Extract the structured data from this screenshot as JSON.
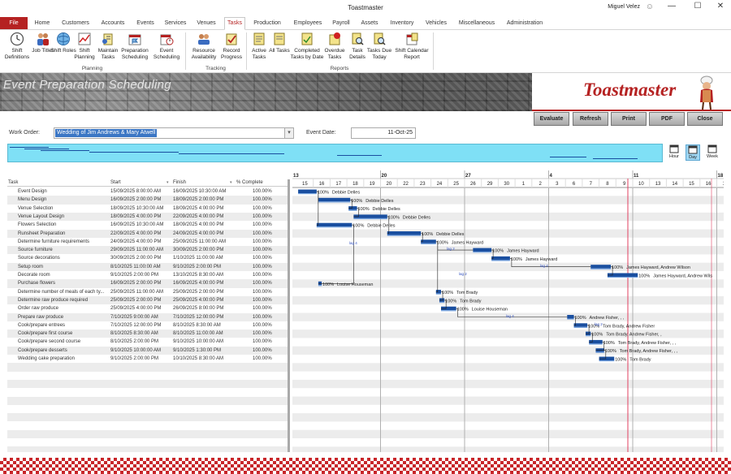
{
  "window": {
    "title": "Toastmaster",
    "user": "Miguel Velez",
    "minimize": "—",
    "maximize": "☐",
    "close": "✕"
  },
  "tabs": [
    {
      "label": "File"
    },
    {
      "label": "Home"
    },
    {
      "label": "Customers"
    },
    {
      "label": "Accounts"
    },
    {
      "label": "Events"
    },
    {
      "label": "Services"
    },
    {
      "label": "Venues"
    },
    {
      "label": "Tasks",
      "active": true
    },
    {
      "label": "Production"
    },
    {
      "label": "Employees"
    },
    {
      "label": "Payroll"
    },
    {
      "label": "Assets"
    },
    {
      "label": "Inventory"
    },
    {
      "label": "Vehicles"
    },
    {
      "label": "Miscellaneous"
    },
    {
      "label": "Administration"
    }
  ],
  "ribbon": {
    "groups": [
      {
        "label": "Planning",
        "buttons": [
          {
            "label": "Shift Definitions",
            "icon": "clock-icon"
          },
          {
            "label": "Job Titles",
            "icon": "people-icon"
          },
          {
            "label": "Shift Roles",
            "icon": "globe-icon"
          },
          {
            "label": "Shift Planning",
            "icon": "chart-icon"
          },
          {
            "label": "Maintain Tasks",
            "icon": "tasks-icon"
          },
          {
            "label": "Preparation Scheduling",
            "icon": "calendar-flag-icon"
          },
          {
            "label": "Event Scheduling",
            "icon": "calendar-clock-icon"
          }
        ]
      },
      {
        "label": "Tracking",
        "buttons": [
          {
            "label": "Resource Availability",
            "icon": "resource-icon"
          },
          {
            "label": "Record Progress",
            "icon": "progress-icon"
          }
        ]
      },
      {
        "label": "Reports",
        "buttons": [
          {
            "label": "Active Tasks",
            "icon": "report-icon"
          },
          {
            "label": "All Tasks",
            "icon": "report-icon"
          },
          {
            "label": "Completed Tasks by Date",
            "icon": "report-icon"
          },
          {
            "label": "Overdue Tasks",
            "icon": "overdue-icon"
          },
          {
            "label": "Task Details",
            "icon": "report-search-icon"
          },
          {
            "label": "Tasks Due Today",
            "icon": "report-search-icon"
          },
          {
            "label": "Shift Calendar Report",
            "icon": "calendar-report-icon"
          }
        ]
      }
    ]
  },
  "banner": {
    "page_title": "Event Preparation Scheduling",
    "logo": "Toastmaster"
  },
  "actions": {
    "evaluate": "Evaluate",
    "refresh": "Refresh",
    "print": "Print",
    "pdf": "PDF",
    "close": "Close"
  },
  "form": {
    "work_order_label": "Work Order:",
    "work_order_value": "Wedding of Jim Andrews & Mary Atwell",
    "event_date_label": "Event Date:",
    "event_date_value": "11-Oct-25"
  },
  "zoom": {
    "hour": "Hour",
    "day": "Day",
    "week": "Week"
  },
  "table": {
    "headers": {
      "task": "Task",
      "start": "Start",
      "finish": "Finish",
      "pct": "% Complete"
    },
    "rows": [
      {
        "task": "Event Design",
        "start": "15/09/2025 8:00:00 AM",
        "finish": "16/09/2025 10:30:00 AM",
        "pct": "100.00%"
      },
      {
        "task": "Menu Design",
        "start": "16/09/2025 2:00:00 PM",
        "finish": "18/09/2025 2:00:00 PM",
        "pct": "100.00%"
      },
      {
        "task": "Venue Selection",
        "start": "18/09/2025 10:30:00 AM",
        "finish": "18/09/2025 4:00:00 PM",
        "pct": "100.00%"
      },
      {
        "task": "Venue Layout Design",
        "start": "18/09/2025 4:00:00 PM",
        "finish": "22/09/2025 4:00:00 PM",
        "pct": "100.00%"
      },
      {
        "task": "Flowers Selection",
        "start": "16/09/2025 10:30:00 AM",
        "finish": "18/09/2025 4:00:00 PM",
        "pct": "100.00%"
      },
      {
        "task": "Runsheet Preparation",
        "start": "22/09/2025 4:00:00 PM",
        "finish": "24/09/2025 4:00:00 PM",
        "pct": "100.00%"
      },
      {
        "task": "Determine furniture requirements",
        "start": "24/09/2025 4:00:00 PM",
        "finish": "25/09/2025 11:00:00 AM",
        "pct": "100.00%"
      },
      {
        "task": "Source furniture",
        "start": "29/09/2025 11:00:00 AM",
        "finish": "30/09/2025 2:00:00 PM",
        "pct": "100.00%"
      },
      {
        "task": "Source decorations",
        "start": "30/09/2025 2:00:00 PM",
        "finish": "1/10/2025 11:00:00 AM",
        "pct": "100.00%"
      },
      {
        "task": "Setup room",
        "start": "8/10/2025 11:00:00 AM",
        "finish": "9/10/2025 2:00:00 PM",
        "pct": "100.00%"
      },
      {
        "task": "Decorate room",
        "start": "9/10/2025 2:00:00 PM",
        "finish": "13/10/2025 8:30:00 AM",
        "pct": "100.00%"
      },
      {
        "task": "Purchase flowers",
        "start": "16/09/2025 2:00:00 PM",
        "finish": "16/09/2025 4:00:00 PM",
        "pct": "100.00%"
      },
      {
        "task": "Determine number of meals of each ty...",
        "start": "25/09/2025 11:00:00 AM",
        "finish": "25/09/2025 2:00:00 PM",
        "pct": "100.00%"
      },
      {
        "task": "Determine raw produce required",
        "start": "25/09/2025 2:00:00 PM",
        "finish": "25/09/2025 4:00:00 PM",
        "pct": "100.00%"
      },
      {
        "task": "Order raw produce",
        "start": "25/09/2025 4:00:00 PM",
        "finish": "26/09/2025 8:00:00 PM",
        "pct": "100.00%"
      },
      {
        "task": "Prepare raw produce",
        "start": "7/10/2025 9:00:00 AM",
        "finish": "7/10/2025 12:00:00 PM",
        "pct": "100.00%"
      },
      {
        "task": "Cook/prepare entrees",
        "start": "7/10/2025 12:00:00 PM",
        "finish": "8/10/2025 8:30:00 AM",
        "pct": "100.00%"
      },
      {
        "task": "Cook/prepare first course",
        "start": "8/10/2025 8:30:00 AM",
        "finish": "8/10/2025 11:00:00 AM",
        "pct": "100.00%"
      },
      {
        "task": "Cook/prepare second course",
        "start": "8/10/2025 2:00:00 PM",
        "finish": "9/10/2025 10:00:00 AM",
        "pct": "100.00%"
      },
      {
        "task": "Cook/prepare desserts",
        "start": "9/10/2025 10:00:00 AM",
        "finish": "9/10/2025 1:30:00 PM",
        "pct": "100.00%"
      },
      {
        "task": "Wedding cake preparation",
        "start": "9/10/2025 2:00:00 PM",
        "finish": "10/10/2025 8:30:00 AM",
        "pct": "100.00%"
      }
    ]
  },
  "gantt": {
    "week_labels": [
      "13",
      "20",
      "27",
      "4",
      "11",
      "18"
    ],
    "day_labels": [
      "15",
      "16",
      "17",
      "18",
      "19",
      "20",
      "22",
      "23",
      "24",
      "25",
      "26",
      "29",
      "30",
      "1",
      "2",
      "3",
      "6",
      "7",
      "8",
      "9",
      "10",
      "13",
      "14",
      "15",
      "16",
      "17",
      "20"
    ],
    "bar_pct_label": "100%",
    "resources": [
      "Debbie Delles",
      "Debbie Delles",
      "Debbie Delles",
      "Debbie Delles",
      "Debbie Delles",
      "Debbie Delles",
      "James Hayward",
      "James Hayward",
      "James Hayward",
      "James Hayward, Andrew Wilson",
      "James Hayward, Andrew Wils",
      "Louise Houseman",
      "Tom Brady",
      "Tom Brady",
      "Louise Houseman",
      "Andrew Fisher, , ,",
      "Tom Brady, Andrew Fisher",
      "Tom Brady, Andrew Fisher, ,",
      "Tom Brady, Andrew Fisher, , ,",
      "Tom Brady, Andrew Fisher, , ,",
      "Tom Brady"
    ],
    "lag_labels": [
      "lag 4",
      "lag 2",
      "lag 4",
      "lag 2",
      "lag 4",
      "lag 2"
    ],
    "colors": {
      "bar": "#1a4fa0",
      "today_line": "#e04060",
      "grid": "#d8d8d8"
    }
  }
}
